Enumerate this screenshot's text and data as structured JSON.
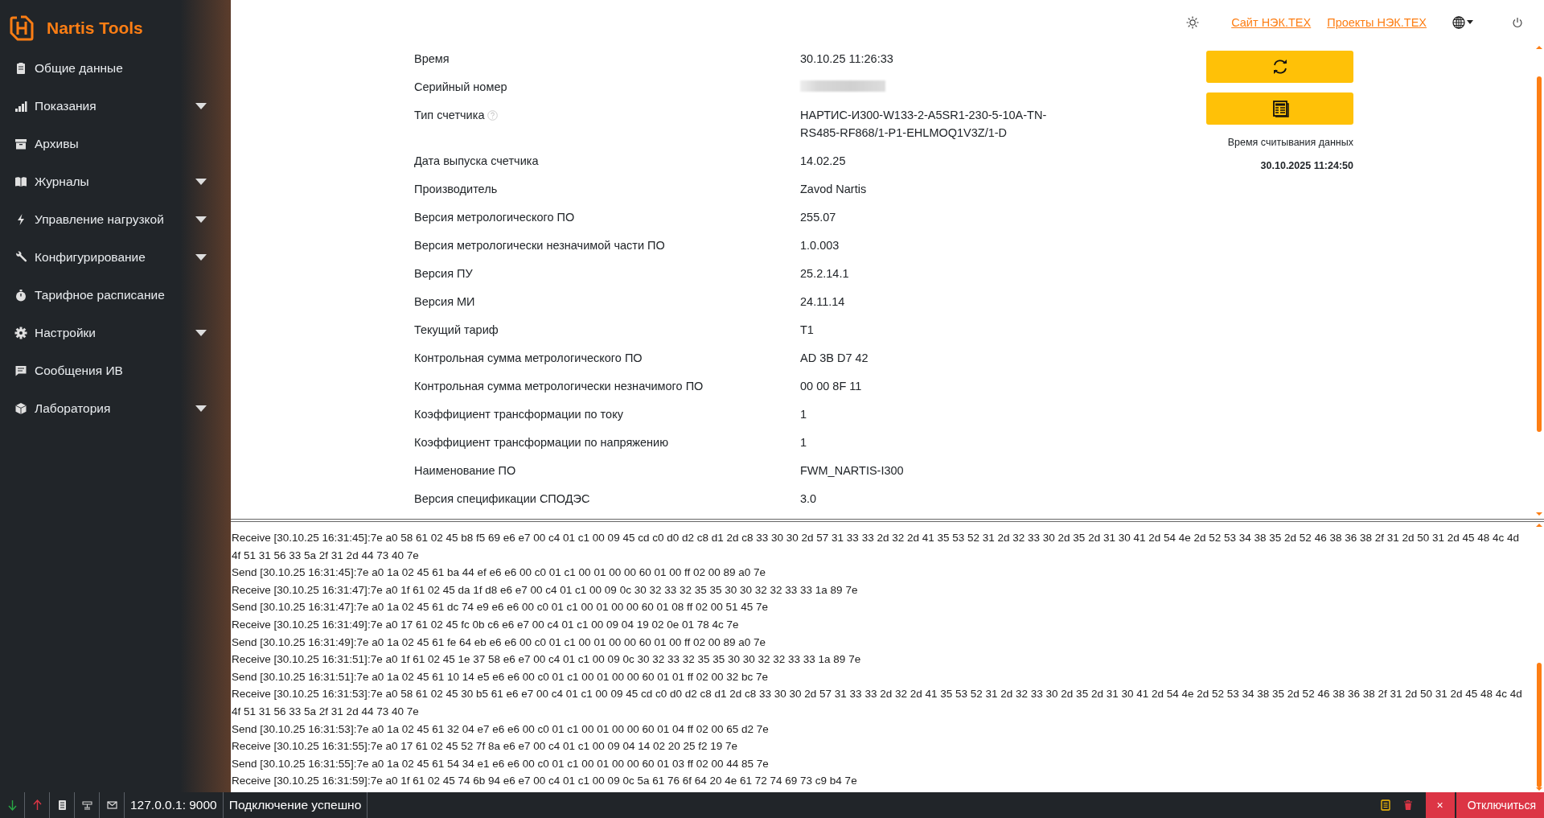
{
  "sidebar": {
    "brand": "Nartis Tools",
    "items": [
      {
        "label": "Общие данные",
        "expandable": false
      },
      {
        "label": "Показания",
        "expandable": true
      },
      {
        "label": "Архивы",
        "expandable": false
      },
      {
        "label": "Журналы",
        "expandable": true
      },
      {
        "label": "Управление нагрузкой",
        "expandable": true
      },
      {
        "label": "Конфигурирование",
        "expandable": true
      },
      {
        "label": "Тарифное расписание",
        "expandable": false
      },
      {
        "label": "Настройки",
        "expandable": true
      },
      {
        "label": "Сообщения ИВ",
        "expandable": false
      },
      {
        "label": "Лаборатория",
        "expandable": true
      }
    ]
  },
  "header": {
    "links": [
      "Сайт НЭК.ТЕХ",
      "Проекты НЭК.ТЕХ"
    ]
  },
  "details": {
    "rows": [
      {
        "label": "Время",
        "value": "30.10.25 11:26:33"
      },
      {
        "label": "Серийный номер",
        "redacted": true
      },
      {
        "label": "Тип счетчика",
        "hint": true,
        "value": "НАРТИС-И300-W133-2-A5SR1-230-5-10A-TN-RS485-RF868/1-P1-EHLMOQ1V3Z/1-D"
      },
      {
        "label": "Дата выпуска счетчика",
        "value": "14.02.25"
      },
      {
        "label": "Производитель",
        "value": "Zavod Nartis"
      },
      {
        "label": "Версия метрологического ПО",
        "value": "255.07"
      },
      {
        "label": "Версия метрологически незначимой части ПО",
        "value": "1.0.003"
      },
      {
        "label": "Версия ПУ",
        "value": "25.2.14.1"
      },
      {
        "label": "Версия МИ",
        "value": "24.11.14"
      },
      {
        "label": "Текущий тариф",
        "value": "T1"
      },
      {
        "label": "Контрольная сумма метрологического ПО",
        "value": "AD 3B D7 42"
      },
      {
        "label": "Контрольная сумма метрологически незначимого ПО",
        "value": "00 00 8F 11"
      },
      {
        "label": "Коэффициент трансформации по току",
        "value": "1"
      },
      {
        "label": "Коэффициент трансформации по напряжению",
        "value": "1"
      },
      {
        "label": "Наименование ПО",
        "value": "FWM_NARTIS-I300"
      },
      {
        "label": "Версия спецификации СПОДЭС",
        "value": "3.0"
      }
    ]
  },
  "read_panel": {
    "caption": "Время считывания данных",
    "time": "30.10.2025 11:24:50"
  },
  "log": [
    "Receive [30.10.25 16:31:45]:7e a0 58 61 02 45 b8 f5 69 e6 e7 00 c4 01 c1 00 09 45 cd c0 d0 d2 c8 d1 2d c8 33 30 30 2d 57 31 33 33 2d 32 2d 41 35 53 52 31 2d 32 33 30 2d 35 2d 31 30 41 2d 54 4e 2d 52 53 34 38 35 2d 52 46 38 36 38 2f 31 2d 50 31 2d 45 48 4c 4d 4f 51 31 56 33 5a 2f 31 2d 44 73 40 7e",
    "Send [30.10.25 16:31:45]:7e a0 1a 02 45 61 ba 44 ef e6 e6 00 c0 01 c1 00 01 00 00 60 01 00 ff 02 00 89 a0 7e",
    "Receive [30.10.25 16:31:47]:7e a0 1f 61 02 45 da 1f d8 e6 e7 00 c4 01 c1 00 09 0c 30 32 33 32 35 35 30 30 32 32 33 33 1a 89 7e",
    "Send [30.10.25 16:31:47]:7e a0 1a 02 45 61 dc 74 e9 e6 e6 00 c0 01 c1 00 01 00 00 60 01 08 ff 02 00 51 45 7e",
    "Receive [30.10.25 16:31:49]:7e a0 17 61 02 45 fc 0b c6 e6 e7 00 c4 01 c1 00 09 04 19 02 0e 01 78 4c 7e",
    "Send [30.10.25 16:31:49]:7e a0 1a 02 45 61 fe 64 eb e6 e6 00 c0 01 c1 00 01 00 00 60 01 00 ff 02 00 89 a0 7e",
    "Receive [30.10.25 16:31:51]:7e a0 1f 61 02 45 1e 37 58 e6 e7 00 c4 01 c1 00 09 0c 30 32 33 32 35 35 30 30 32 32 33 33 1a 89 7e",
    "Send [30.10.25 16:31:51]:7e a0 1a 02 45 61 10 14 e5 e6 e6 00 c0 01 c1 00 01 00 00 60 01 01 ff 02 00 32 bc 7e",
    "Receive [30.10.25 16:31:53]:7e a0 58 61 02 45 30 b5 61 e6 e7 00 c4 01 c1 00 09 45 cd c0 d0 d2 c8 d1 2d c8 33 30 30 2d 57 31 33 33 2d 32 2d 41 35 53 52 31 2d 32 33 30 2d 35 2d 31 30 41 2d 54 4e 2d 52 53 34 38 35 2d 52 46 38 36 38 2f 31 2d 50 31 2d 45 48 4c 4d 4f 51 31 56 33 5a 2f 31 2d 44 73 40 7e",
    "Send [30.10.25 16:31:53]:7e a0 1a 02 45 61 32 04 e7 e6 e6 00 c0 01 c1 00 01 00 00 60 01 04 ff 02 00 65 d2 7e",
    "Receive [30.10.25 16:31:55]:7e a0 17 61 02 45 52 7f 8a e6 e7 00 c4 01 c1 00 09 04 14 02 20 25 f2 19 7e",
    "Send [30.10.25 16:31:55]:7e a0 1a 02 45 61 54 34 e1 e6 e6 00 c0 01 c1 00 01 00 00 60 01 03 ff 02 00 44 85 7e",
    "Receive [30.10.25 16:31:59]:7e a0 1f 61 02 45 74 6b 94 e6 e7 00 c4 01 c1 00 09 0c 5a 61 76 6f 64 20 4e 61 72 74 69 73 c9 b4 7e"
  ],
  "status_bar": {
    "address": "127.0.0.1: 9000",
    "message": "Подключение успешно",
    "close": "×",
    "disconnect": "Отключиться"
  }
}
